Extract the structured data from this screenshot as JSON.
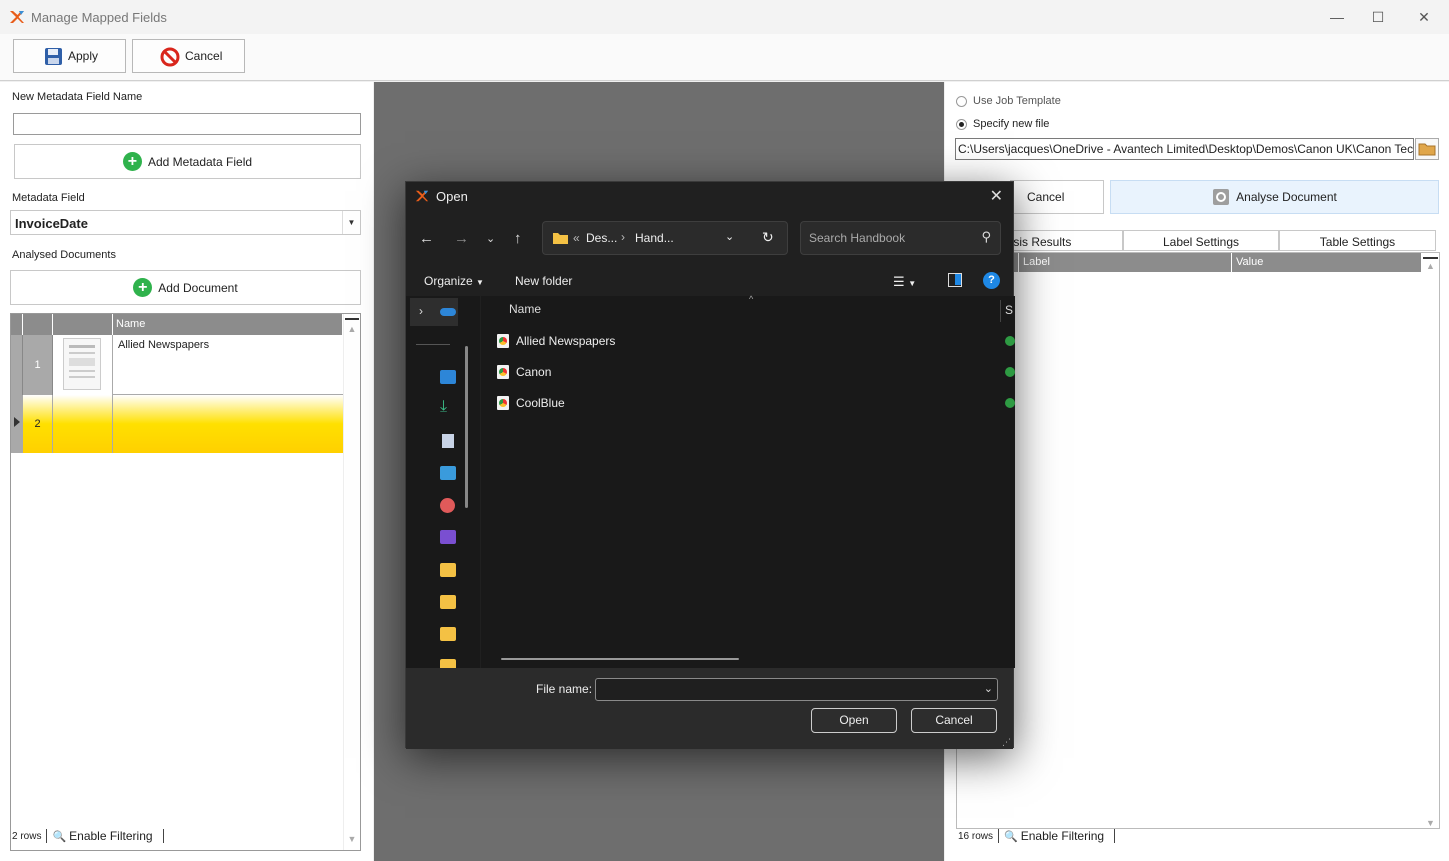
{
  "window": {
    "title": "Manage Mapped Fields",
    "minimize": "—",
    "maximize": "☐",
    "close": "✕"
  },
  "toolbar": {
    "apply_label": "Apply",
    "cancel_label": "Cancel"
  },
  "left": {
    "new_field_label": "New Metadata Field Name",
    "new_field_value": "",
    "add_field_label": "Add Metadata Field",
    "metadata_field_label": "Metadata Field",
    "metadata_field_value": "InvoiceDate",
    "analysed_docs_label": "Analysed Documents",
    "add_document_label": "Add Document",
    "grid": {
      "name_header": "Name",
      "rows": [
        {
          "num": "1",
          "name": "Allied Newspapers"
        },
        {
          "num": "2",
          "name": ""
        }
      ]
    },
    "status": {
      "rows": "2 rows",
      "filter": "Enable Filtering"
    }
  },
  "right": {
    "use_template_label": "Use Job Template",
    "specify_file_label": "Specify new file",
    "path_value": "C:\\Users\\jacques\\OneDrive - Avantech Limited\\Desktop\\Demos\\Canon UK\\Canon Tec",
    "cancel_label": "Cancel",
    "analyse_label": "Analyse Document",
    "tabs": [
      "alysis Results",
      "Label Settings",
      "Table Settings"
    ],
    "columns": [
      "Label",
      "Value"
    ],
    "status": {
      "rows": "16 rows",
      "filter": "Enable Filtering"
    }
  },
  "dialog": {
    "title": "Open",
    "path_part1": "Des...",
    "path_part2": "Hand...",
    "path_prefix": "«",
    "search_placeholder": "Search Handbook",
    "organize_label": "Organize",
    "new_folder_label": "New folder",
    "name_column": "Name",
    "partial_column": "S",
    "files": [
      "Allied Newspapers",
      "Canon",
      "CoolBlue"
    ],
    "file_name_label": "File name:",
    "file_name_value": "",
    "open_label": "Open",
    "cancel_label": "Cancel"
  },
  "colors": {
    "accent_green": "#2fb24c",
    "selected_row_yellow": "#ffe000",
    "dialog_bg": "#202020",
    "help_blue": "#1e88e5"
  }
}
